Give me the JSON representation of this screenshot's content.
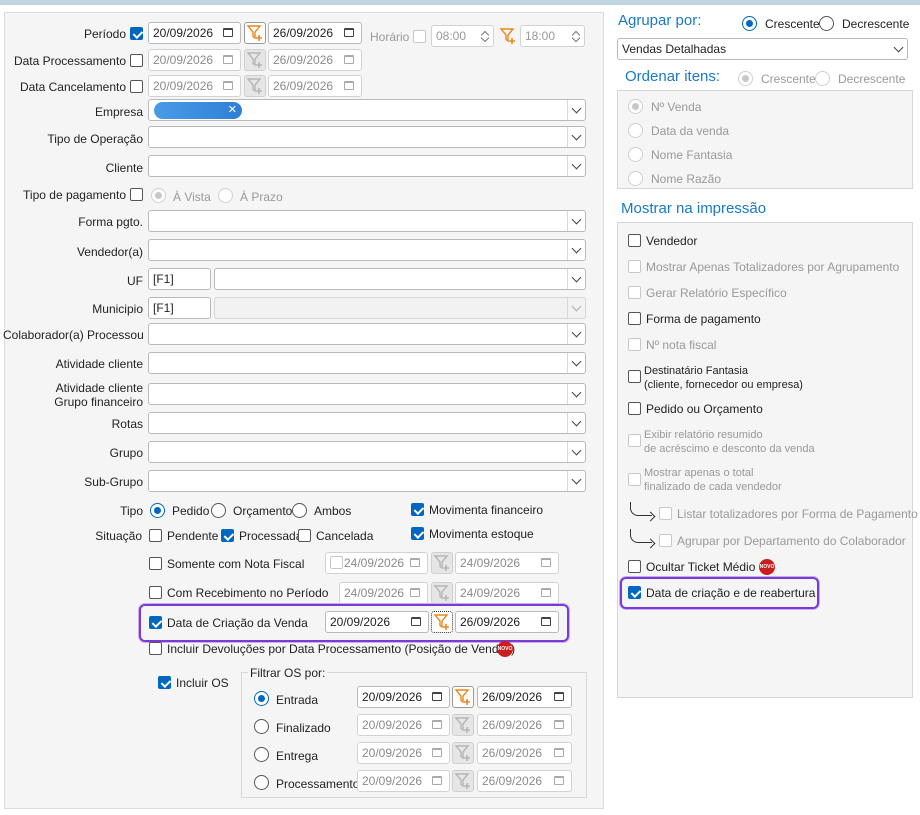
{
  "filters": {
    "periodo": {
      "label": "Período",
      "checked": true,
      "start": "20/09/2026",
      "end": "26/09/2026"
    },
    "horario": {
      "label": "Horário",
      "start": "08:00",
      "end": "18:00"
    },
    "data_processamento": {
      "label": "Data Processamento",
      "start": "20/09/2026",
      "end": "26/09/2026"
    },
    "data_cancelamento": {
      "label": "Data Cancelamento",
      "start": "20/09/2026",
      "end": "26/09/2026"
    },
    "empresa": {
      "label": "Empresa",
      "chip_remove": "✕"
    },
    "tipo_operacao": {
      "label": "Tipo de Operação"
    },
    "cliente": {
      "label": "Cliente"
    },
    "tipo_pagamento": {
      "label": "Tipo de pagamento",
      "avista": "À Vista",
      "aprazo": "À Prazo"
    },
    "forma_pgto": {
      "label": "Forma pgto."
    },
    "vendedor": {
      "label": "Vendedor(a)"
    },
    "uf": {
      "label": "UF",
      "code": "[F1]"
    },
    "municipio": {
      "label": "Municipio",
      "code": "[F1]"
    },
    "colaborador": {
      "label": "Colaborador(a) Processou"
    },
    "atividade_cliente": {
      "label": "Atividade cliente"
    },
    "atividade_grupo": {
      "label_line1": "Atividade cliente",
      "label_line2": "Grupo financeiro"
    },
    "rotas": {
      "label": "Rotas"
    },
    "grupo": {
      "label": "Grupo"
    },
    "subgrupo": {
      "label": "Sub-Grupo"
    },
    "tipo": {
      "label": "Tipo",
      "options": [
        "Pedido",
        "Orçamento",
        "Ambos"
      ],
      "selected": "Pedido"
    },
    "situacao": {
      "label": "Situação",
      "options": [
        "Pendente",
        "Processada",
        "Cancelada"
      ],
      "checked": "Processada"
    },
    "movimenta_financeiro": {
      "label": "Movimenta financeiro",
      "checked": true
    },
    "movimenta_estoque": {
      "label": "Movimenta estoque",
      "checked": true
    },
    "somente_nota_fiscal": {
      "label": "Somente com Nota Fiscal",
      "start": "24/09/2026",
      "end": "24/09/2026"
    },
    "com_recebimento": {
      "label": "Com Recebimento no Período",
      "start": "24/09/2026",
      "end": "24/09/2026"
    },
    "data_criacao_venda": {
      "label": "Data de Criação da Venda",
      "checked": true,
      "start": "20/09/2026",
      "end": "26/09/2026"
    },
    "incluir_devolucoes": {
      "label": "Incluir Devoluções por Data Processamento (Posição de Vendas)",
      "badge": "NOVO"
    },
    "incluir_os": {
      "label": "Incluir OS",
      "checked": true
    },
    "filtrar_os": {
      "title": "Filtrar OS por:",
      "rows": [
        {
          "label": "Entrada",
          "start": "20/09/2026",
          "end": "26/09/2026",
          "selected": true
        },
        {
          "label": "Finalizado",
          "start": "20/09/2026",
          "end": "26/09/2026",
          "selected": false
        },
        {
          "label": "Entrega",
          "start": "20/09/2026",
          "end": "26/09/2026",
          "selected": false
        },
        {
          "label": "Processamento",
          "start": "20/09/2026",
          "end": "26/09/2026",
          "selected": false
        }
      ]
    }
  },
  "agrupar": {
    "title": "Agrupar por:",
    "asc": "Crescente",
    "desc": "Decrescente",
    "selected": "Crescente",
    "value": "Vendas Detalhadas"
  },
  "ordenar": {
    "title": "Ordenar itens:",
    "asc": "Crescente",
    "desc": "Decrescente",
    "options": [
      "Nº Venda",
      "Data da venda",
      "Nome Fantasia",
      "Nome Razão"
    ],
    "selected": "Nº Venda"
  },
  "impressao": {
    "title": "Mostrar na impressão",
    "items": {
      "vendedor": "Vendedor",
      "totalizadores": "Mostrar Apenas Totalizadores por Agrupamento",
      "relatorio": "Gerar Relatório Específico",
      "forma_pagamento": "Forma de pagamento",
      "nota_fiscal": "Nº nota fiscal",
      "destinatario_l1": "Destinatário Fantasia",
      "destinatario_l2": "(cliente, fornecedor ou empresa)",
      "pedido_orcamento": "Pedido ou Orçamento",
      "resumido_l1": "Exibir relatório resumido",
      "resumido_l2": "de acréscimo e desconto da venda",
      "total_vendedor_l1": "Mostrar apenas o total",
      "total_vendedor_l2": "finalizado de cada vendedor",
      "listar_totalizadores": "Listar totalizadores por Forma de Pagamento",
      "agrupar_departamento": "Agrupar por Departamento do Colaborador",
      "ocultar_ticket": "Ocultar Ticket Médio",
      "ticket_badge": "NOVO",
      "data_criacao_reabertura": "Data de criação e de reabertura"
    },
    "data_criacao_reabertura_checked": true
  },
  "colors": {
    "accent": "#0067c0",
    "title_blue": "#1b78c8",
    "highlight": "#7b3ad6",
    "filter_orange": "#e8891c",
    "badge_red": "#c81e1e"
  }
}
